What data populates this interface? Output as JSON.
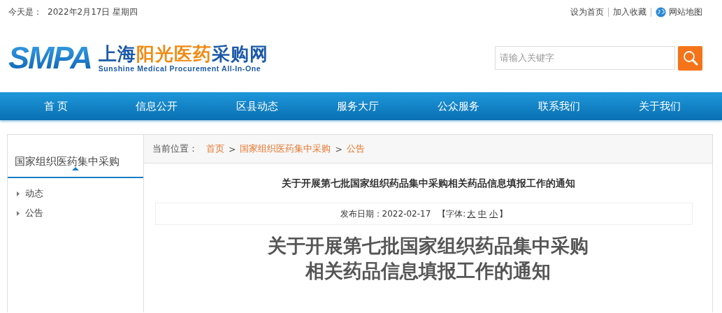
{
  "topbar": {
    "date_label": "今天是：",
    "date": "2022年2月17日 星期四",
    "links": [
      {
        "label": "设为首页",
        "kind": "text"
      },
      {
        "label": "加入收藏",
        "kind": "text"
      },
      {
        "label": "网站地图",
        "kind": "globe"
      }
    ]
  },
  "logo": {
    "mark": "SMPA",
    "title_parts": [
      {
        "text": "上海",
        "accent": false
      },
      {
        "text": "阳光医药",
        "accent": true
      },
      {
        "text": "采购网",
        "accent": false
      }
    ],
    "subtitle": "Sunshine Medical Procurement All-In-One"
  },
  "search": {
    "placeholder": "请输入关键字"
  },
  "nav": [
    "首 页",
    "信息公开",
    "区县动态",
    "服务大厅",
    "公众服务",
    "联系我们",
    "关于我们"
  ],
  "sidebar": {
    "title": "国家组织医药集中采购",
    "items": [
      "动态",
      "公告"
    ]
  },
  "breadcrumb": {
    "label": "当前位置：",
    "items": [
      "首页",
      "国家组织医药集中采购",
      "公告"
    ],
    "separator": ">"
  },
  "article": {
    "title": "关于开展第七批国家组织药品集中采购相关药品信息填报工作的通知",
    "date": "发布日期：2022-02-17",
    "font_open": "【字体:",
    "font_sizes": [
      "大",
      "中",
      "小"
    ],
    "font_close": "】",
    "heading_lines": [
      "关于开展第七批国家组织药品集中采购",
      "相关药品信息填报工作的通知"
    ]
  }
}
